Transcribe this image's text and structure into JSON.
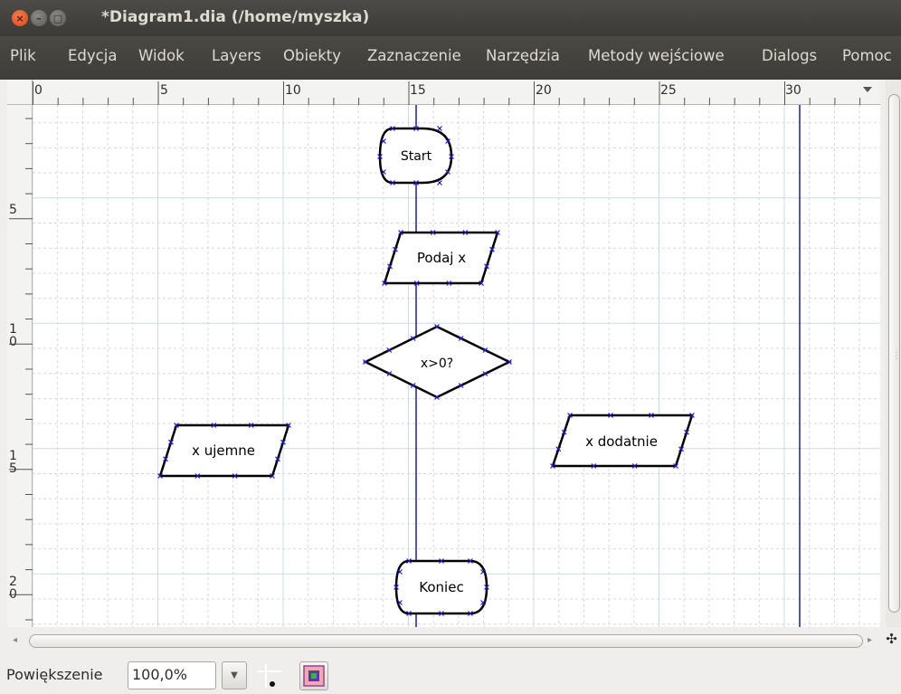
{
  "window": {
    "title": "*Diagram1.dia (/home/myszka)",
    "close_symbol": "×",
    "min_symbol": "–",
    "max_symbol": "□"
  },
  "menu": [
    "Plik",
    "Edycja",
    "Widok",
    "Layers",
    "Obiekty",
    "Zaznaczenie",
    "Narzędzia",
    "Metody wejściowe",
    "Dialogs",
    "Pomoc"
  ],
  "ruler": {
    "h_labels": [
      "0",
      "5",
      "10",
      "15",
      "20",
      "25",
      "30"
    ],
    "v_labels": [
      "5",
      "10",
      "15",
      "20"
    ]
  },
  "diagram": {
    "nodes": [
      {
        "id": "start",
        "shape": "terminal",
        "label": "Start"
      },
      {
        "id": "input",
        "shape": "parallelogram",
        "label": "Podaj x"
      },
      {
        "id": "decision",
        "shape": "diamond",
        "label": "x>0?"
      },
      {
        "id": "negative",
        "shape": "parallelogram",
        "label": "x ujemne"
      },
      {
        "id": "positive",
        "shape": "parallelogram",
        "label": "x dodatnie"
      },
      {
        "id": "end",
        "shape": "terminal",
        "label": "Koniec"
      }
    ],
    "colors": {
      "grid_major": "#c9dde0",
      "grid_minor": "#d7d7d7",
      "guide_line": "#1f1f8f",
      "shape_stroke": "#000000",
      "connection_point": "#1c1cc4"
    }
  },
  "statusbar": {
    "zoom_label": "Powiększenie",
    "zoom_value": "100,0%"
  },
  "icons": {
    "zoom_dropdown": "chevron-down-icon",
    "snap": "snap-to-grid-icon",
    "layers": "layers-icon",
    "scroll_left": "arrow-left-icon",
    "scroll_right": "arrow-right-icon",
    "scroll_up": "arrow-up-icon",
    "scroll_down": "arrow-down-icon",
    "navigate": "move-cross-icon"
  }
}
